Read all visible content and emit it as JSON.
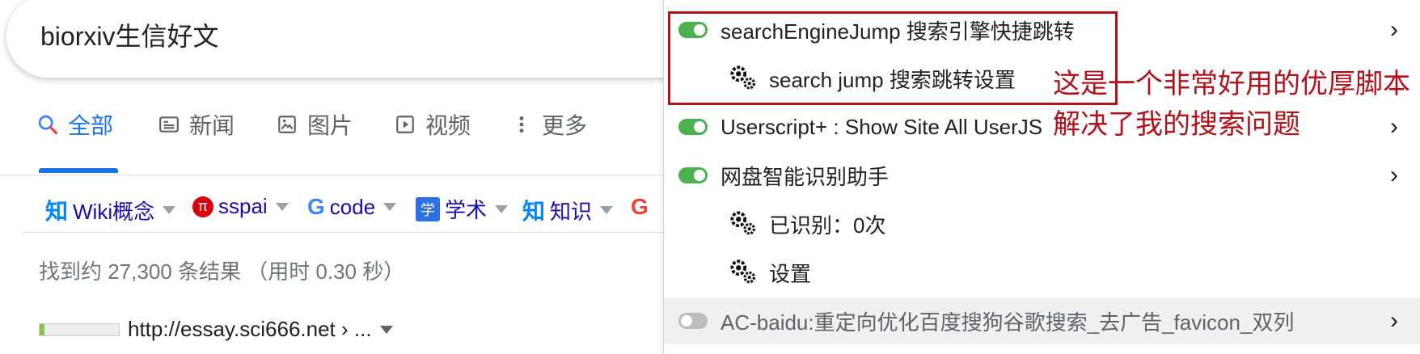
{
  "search": {
    "query": "biorxiv生信好文"
  },
  "tabs": [
    {
      "label": "全部",
      "icon": "search-icon",
      "active": true
    },
    {
      "label": "新闻",
      "icon": "news-icon"
    },
    {
      "label": "图片",
      "icon": "image-icon"
    },
    {
      "label": "视频",
      "icon": "video-icon"
    },
    {
      "label": "更多",
      "icon": "more-vert-icon"
    }
  ],
  "engines": [
    {
      "badge": "知",
      "label": "Wiki概念"
    },
    {
      "badge": "π",
      "label": "sspai"
    },
    {
      "badge": "G",
      "label": "code"
    },
    {
      "badge": "学",
      "label": "学术"
    },
    {
      "badge": "知",
      "label": "知识"
    },
    {
      "badge": "G",
      "label": ""
    }
  ],
  "results": {
    "stats": "找到约 27,300 条结果 （用时 0.30 秒）",
    "first_url": "http://essay.sci666.net › ..."
  },
  "menu": {
    "items": [
      {
        "type": "script",
        "enabled": true,
        "label": "searchEngineJump 搜索引擎快捷跳转"
      },
      {
        "type": "command",
        "label": "search jump 搜索跳转设置"
      },
      {
        "type": "script",
        "enabled": true,
        "label": "Userscript+ : Show Site All UserJS"
      },
      {
        "type": "script",
        "enabled": true,
        "label": "网盘智能识别助手"
      },
      {
        "type": "command",
        "label": "已识别：0次"
      },
      {
        "type": "command",
        "label": "设置"
      },
      {
        "type": "script",
        "enabled": false,
        "label": "AC-baidu:重定向优化百度搜狗谷歌搜索_去广告_favicon_双列"
      }
    ]
  },
  "annotation": {
    "line1": "这是一个非常好用的优厚脚本",
    "line2": "解决了我的搜索问题"
  },
  "colors": {
    "accent": "#1a73e8",
    "toggle_on": "#4caf50",
    "annotation": "#b0121c",
    "link": "#1a0dab"
  }
}
